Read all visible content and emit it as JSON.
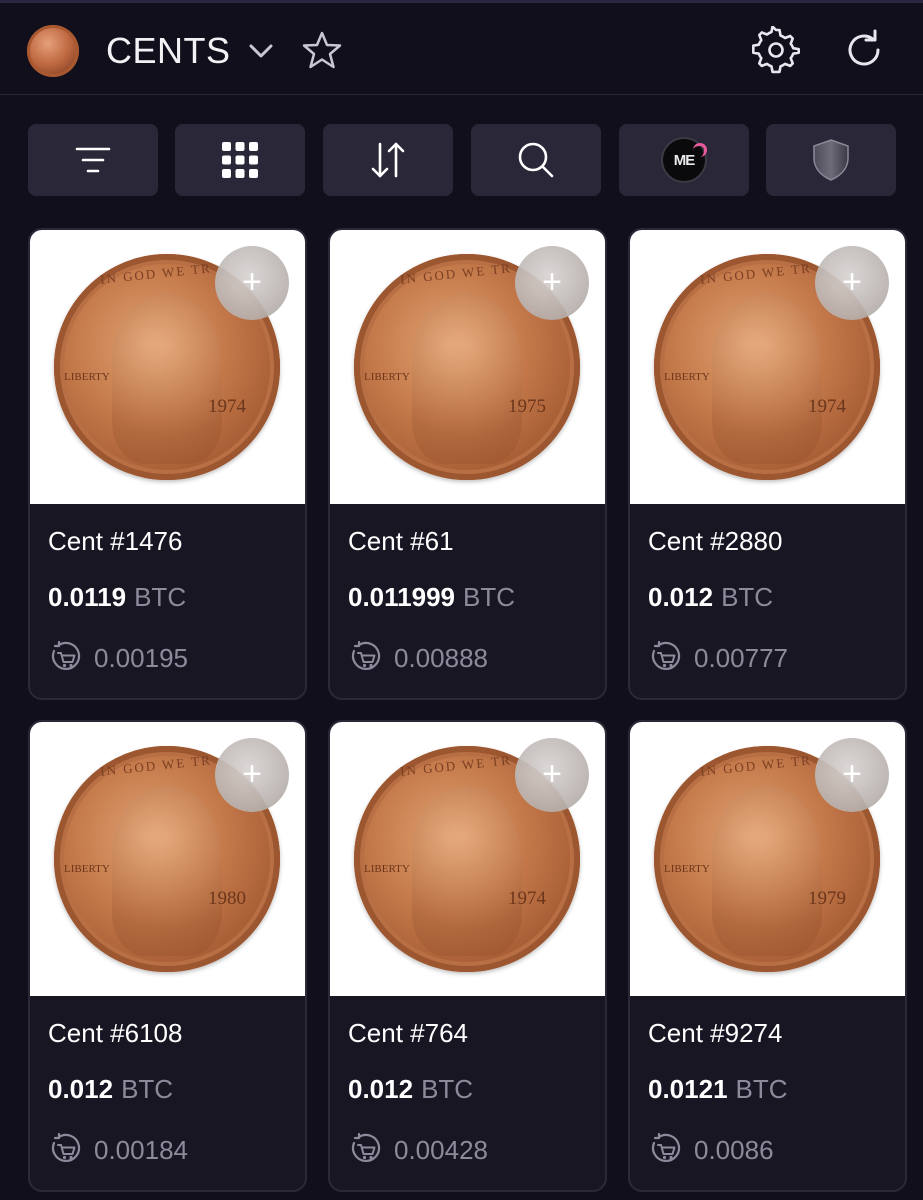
{
  "header": {
    "title": "CENTS"
  },
  "toolbar": {
    "buttons": [
      "filter-icon",
      "grid-icon",
      "sort-icon",
      "search-icon",
      "magic-eden-icon",
      "shield-icon"
    ],
    "magic_eden_text": "ME"
  },
  "items": [
    {
      "name": "Cent #1476",
      "price": "0.0119",
      "unit": "BTC",
      "last": "0.00195",
      "year": "1974",
      "motto": "IN GOD WE TR",
      "liberty": "LIBERTY"
    },
    {
      "name": "Cent #61",
      "price": "0.011999",
      "unit": "BTC",
      "last": "0.00888",
      "year": "1975",
      "motto": "IN GOD WE TR",
      "liberty": "LIBERTY"
    },
    {
      "name": "Cent #2880",
      "price": "0.012",
      "unit": "BTC",
      "last": "0.00777",
      "year": "1974",
      "motto": "IN GOD WE TR",
      "liberty": "LIBERTY"
    },
    {
      "name": "Cent #6108",
      "price": "0.012",
      "unit": "BTC",
      "last": "0.00184",
      "year": "1980",
      "motto": "IN GOD WE TR",
      "liberty": "LIBERTY"
    },
    {
      "name": "Cent #764",
      "price": "0.012",
      "unit": "BTC",
      "last": "0.00428",
      "year": "1974",
      "motto": "IN GOD WE TR",
      "liberty": "LIBERTY"
    },
    {
      "name": "Cent #9274",
      "price": "0.0121",
      "unit": "BTC",
      "last": "0.0086",
      "year": "1979",
      "motto": "IN GOD WE TR",
      "liberty": "LIBERTY"
    }
  ],
  "colors": {
    "background": "#120f1c",
    "card": "#191624",
    "toolbar_button": "#2a2738",
    "muted_text": "#8e8a9c"
  }
}
